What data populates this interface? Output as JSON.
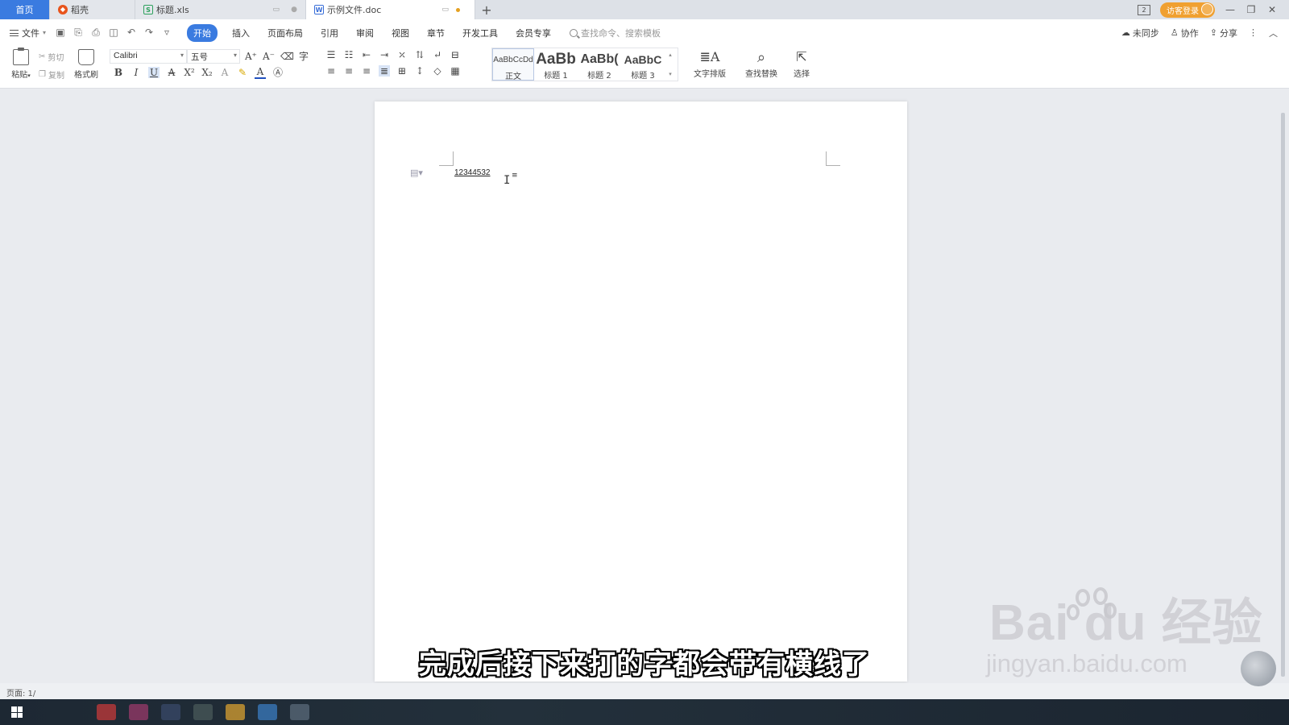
{
  "tabs": {
    "home": "首页",
    "daoke": "稻壳",
    "xls": "标题.xls",
    "doc": "示例文件.doc",
    "new_tab": "+"
  },
  "titlebar": {
    "box_label": "2",
    "login_label": "访客登录",
    "minimize": "—",
    "restore": "❐",
    "close": "✕"
  },
  "menu": {
    "file_label": "文件",
    "items": [
      "开始",
      "插入",
      "页面布局",
      "引用",
      "审阅",
      "视图",
      "章节",
      "开发工具",
      "会员专享"
    ],
    "active_index": 0,
    "search_placeholder": "查找命令、搜索模板",
    "sync_label": "未同步",
    "collab_label": "协作",
    "share_label": "分享"
  },
  "ribbon": {
    "paste_label": "粘贴",
    "cut_label": "剪切",
    "copy_label": "复制",
    "format_painter_label": "格式刷",
    "font_name": "Calibri",
    "font_size": "五号",
    "styles": [
      {
        "preview": "AaBbCcDd",
        "label": "正文"
      },
      {
        "preview": "AaBb",
        "label": "标题 1"
      },
      {
        "preview": "AaBb(",
        "label": "标题 2"
      },
      {
        "preview": "AaBbC",
        "label": "标题 3"
      }
    ],
    "text_layout_label": "文字排版",
    "find_replace_label": "查找替换",
    "select_label": "选择"
  },
  "document": {
    "text": "12344532"
  },
  "status": {
    "page_label": "页面: 1/"
  },
  "overlay": {
    "subtitle": "完成后接下来打的字都会带有横线了",
    "watermark_brand": "Bai  du 经验",
    "watermark_url": "jingyan.baidu.com"
  },
  "colors": {
    "accent": "#3a7be0",
    "login": "#f0a030"
  }
}
